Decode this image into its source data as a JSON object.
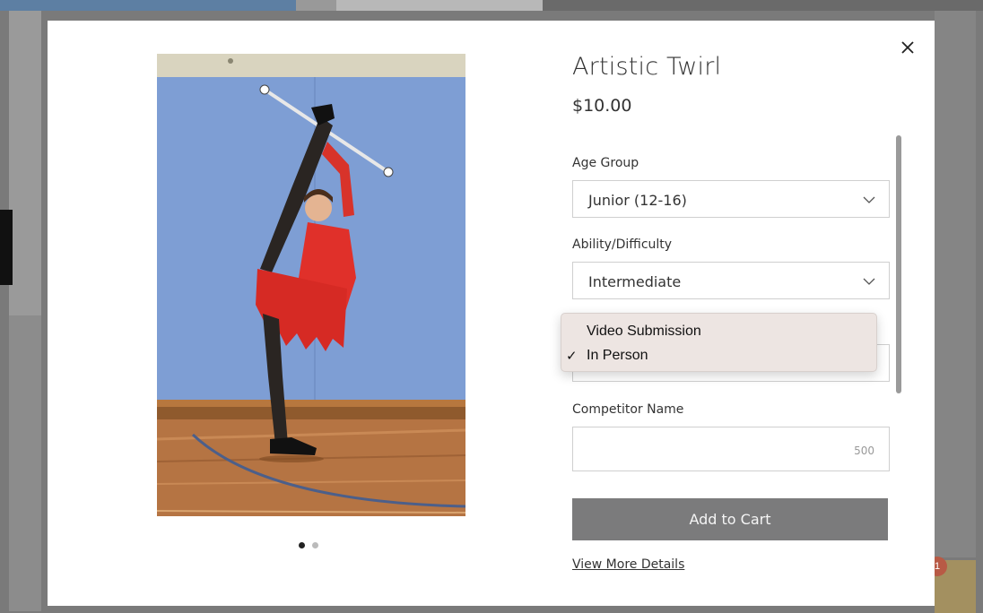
{
  "product": {
    "title": "Artistic Twirl",
    "price": "$10.00",
    "image_dots": 2,
    "active_image": 1
  },
  "options": {
    "age_group": {
      "label": "Age Group",
      "value": "Junior (12-16)"
    },
    "ability": {
      "label": "Ability/Difficulty",
      "value": "Intermediate"
    },
    "format": {
      "items": [
        {
          "label": "Video Submission",
          "checked": false
        },
        {
          "label": "In Person",
          "checked": true
        }
      ]
    },
    "competitor_name": {
      "label": "Competitor Name",
      "char_limit": "500"
    }
  },
  "actions": {
    "add_to_cart": "Add to Cart",
    "view_details": "View More Details"
  },
  "background": {
    "notification_count": "1"
  },
  "icons": {
    "close": "close-icon",
    "chevron": "chevron-down-icon",
    "check": "checkmark-icon"
  },
  "colors": {
    "button_bg": "#7b7b7c",
    "overlay": "#7a7a7a",
    "dropdown_bg": "#ede5e2",
    "notification": "#b85a45"
  }
}
